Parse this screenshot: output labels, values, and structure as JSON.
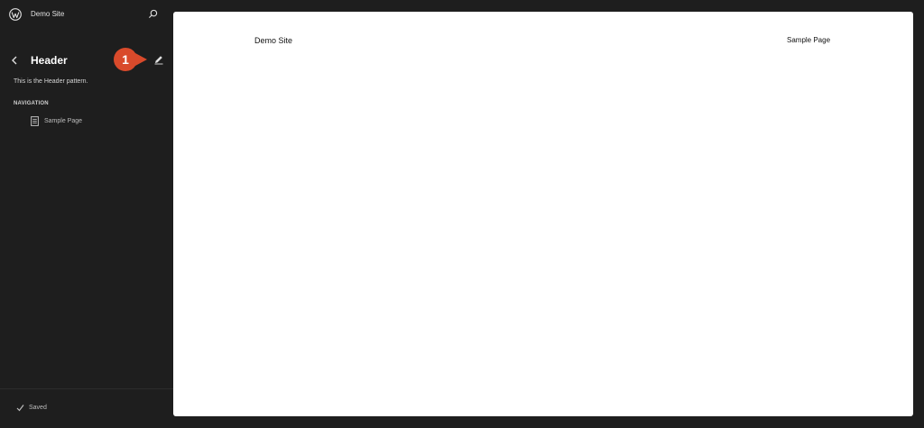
{
  "sidebar": {
    "site_title": "Demo Site",
    "panel": {
      "title": "Header",
      "badge_number": "1",
      "description": "This is the Header pattern.",
      "section_heading": "NAVIGATION",
      "nav_items": [
        {
          "label": "Sample Page",
          "icon": "page-icon"
        }
      ]
    },
    "footer": {
      "status": "Saved",
      "icon": "check-icon"
    }
  },
  "canvas": {
    "site_title": "Demo Site",
    "nav_link": "Sample Page"
  },
  "colors": {
    "sidebar_bg": "#1e1e1e",
    "canvas_bg": "#ffffff",
    "badge": "#d94a2b"
  },
  "icons": {
    "logo": "wordpress-logo-icon",
    "search": "search-icon",
    "back": "chevron-left-icon",
    "edit": "pencil-icon"
  }
}
